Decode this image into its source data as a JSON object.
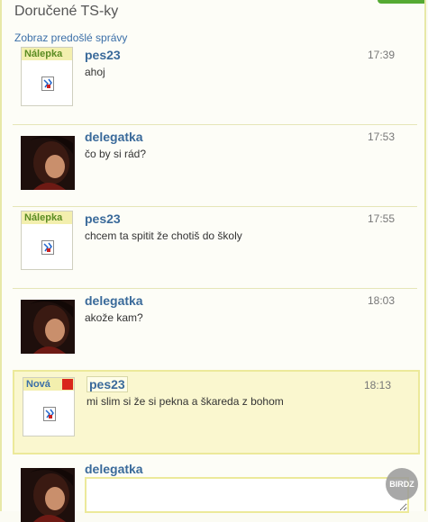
{
  "header": {
    "title": "Doručené TS-ky",
    "prev_link": "Zobraz predošlé správy"
  },
  "messages": [
    {
      "author": "pes23",
      "time": "17:39",
      "text": "ahoj",
      "sticker_label": "Nálepka"
    },
    {
      "author": "delegatka",
      "time": "17:53",
      "text": "čo by si rád?"
    },
    {
      "author": "pes23",
      "time": "17:55",
      "text": "chcem ta spitit že chotiš do školy",
      "sticker_label": "Nálepka"
    },
    {
      "author": "delegatka",
      "time": "18:03",
      "text": "akože kam?"
    },
    {
      "author": "pes23",
      "time": "18:13",
      "text": "mi slim si že si pekna a škareda z bohom",
      "sticker_label": "Nová"
    },
    {
      "author": "delegatka"
    }
  ],
  "watermark": "BIRDZ",
  "colors": {
    "accent_link": "#3b6fa8",
    "new_highlight": "#faf7cf",
    "new_flag": "#d9261c"
  }
}
